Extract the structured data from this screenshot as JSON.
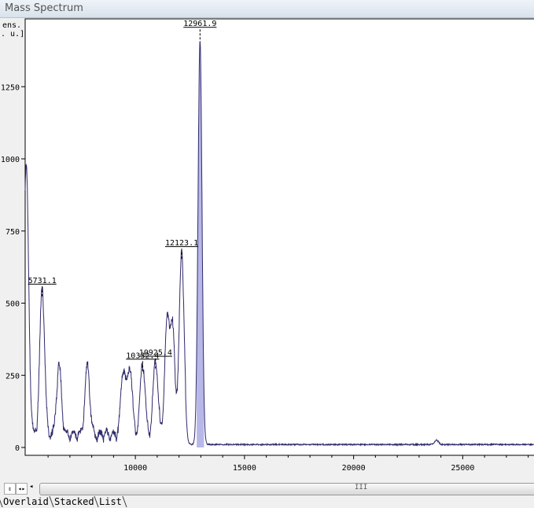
{
  "window": {
    "title": "Mass Spectrum"
  },
  "tabs": [
    "Overlaid",
    "Stacked",
    "List"
  ],
  "scroll": {
    "grip": "III"
  },
  "chart_data": {
    "type": "line",
    "title": "Mass Spectrum",
    "ylabel_lines": [
      "ens.",
      ". u.]"
    ],
    "xlim": [
      4950,
      28270
    ],
    "ylim": [
      0,
      1480
    ],
    "xticks": [
      10000,
      15000,
      20000,
      25000
    ],
    "yticks": [
      0,
      250,
      500,
      750,
      1000,
      1250
    ],
    "peaks": [
      {
        "mz": 5000,
        "intensity": 930
      },
      {
        "mz": 5731.1,
        "intensity": 510,
        "label": "5731.1"
      },
      {
        "mz": 6500,
        "intensity": 240
      },
      {
        "mz": 7800,
        "intensity": 240
      },
      {
        "mz": 9450,
        "intensity": 230
      },
      {
        "mz": 9750,
        "intensity": 235
      },
      {
        "mz": 10332.4,
        "intensity": 250,
        "label": "10332.4"
      },
      {
        "mz": 10925.4,
        "intensity": 260,
        "label": "10925.4"
      },
      {
        "mz": 11450,
        "intensity": 375
      },
      {
        "mz": 11700,
        "intensity": 360
      },
      {
        "mz": 12123.1,
        "intensity": 640,
        "label": "12123.1"
      },
      {
        "mz": 12961.9,
        "intensity": 1400,
        "label": "12961.9"
      },
      {
        "mz": 23800,
        "intensity": 15
      }
    ],
    "highlight_range": [
      12800,
      13150
    ],
    "colors": {
      "line": "#2e2a6b",
      "fill": "#b8b8e8"
    }
  }
}
